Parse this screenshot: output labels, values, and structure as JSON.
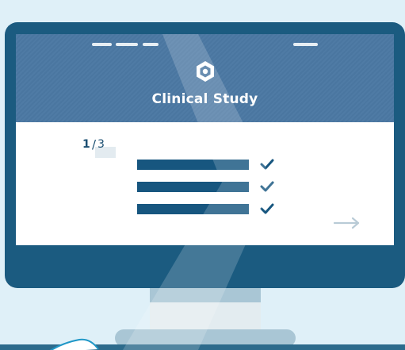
{
  "screen": {
    "title": "Clinical Study",
    "logo_icon": "hexagon-ring-logo-icon",
    "nav": {
      "left_dash_count": 3,
      "right_dash_count": 1
    }
  },
  "progress": {
    "current": "1",
    "separator": "/",
    "total": "3"
  },
  "checklist": {
    "items": [
      {
        "checked": true,
        "check_icon": "checkmark-icon"
      },
      {
        "checked": true,
        "check_icon": "checkmark-icon"
      },
      {
        "checked": true,
        "check_icon": "checkmark-icon"
      }
    ]
  },
  "navigation": {
    "next_icon": "right-arrow-icon"
  },
  "colors": {
    "header": "#4a76a0",
    "frame": "#1b5b80",
    "bar": "#17567f",
    "background": "#dff0f8"
  }
}
